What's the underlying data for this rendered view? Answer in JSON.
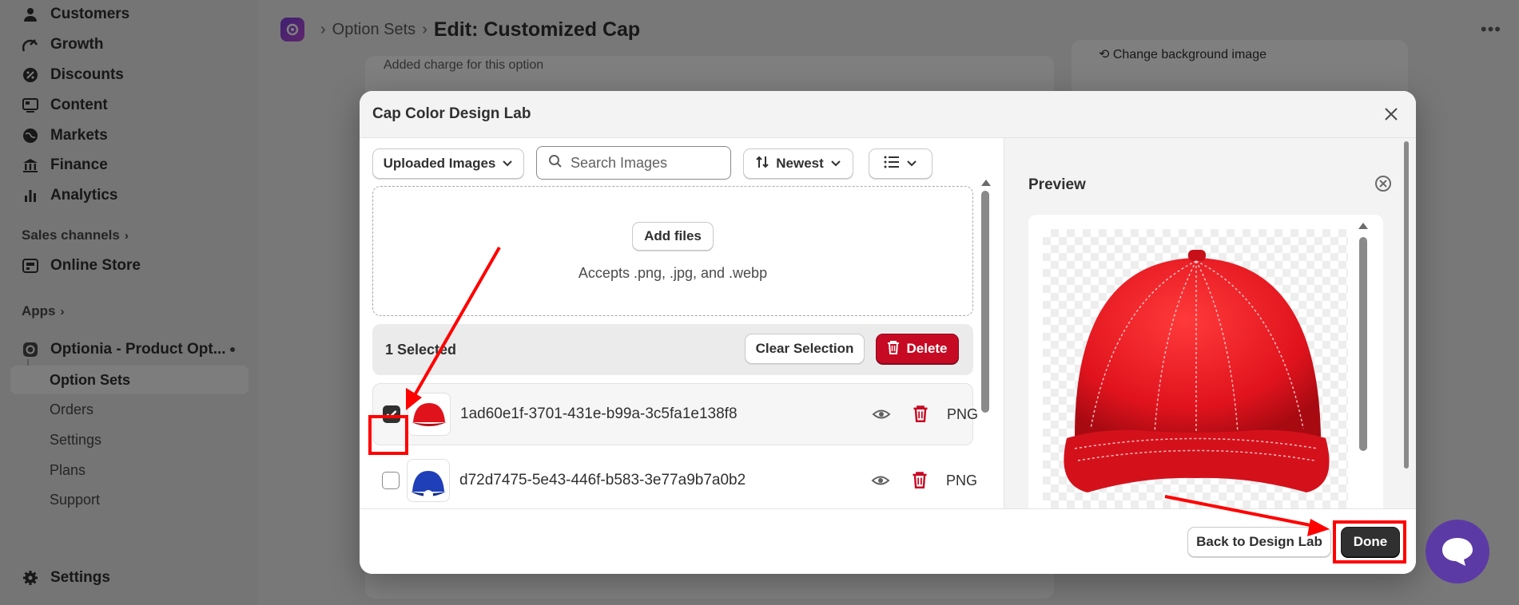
{
  "sidebar": {
    "items": [
      {
        "label": "Customers",
        "icon": "person-icon"
      },
      {
        "label": "Growth",
        "icon": "growth-icon"
      },
      {
        "label": "Discounts",
        "icon": "discount-icon"
      },
      {
        "label": "Content",
        "icon": "content-icon"
      },
      {
        "label": "Markets",
        "icon": "globe-icon"
      },
      {
        "label": "Finance",
        "icon": "bank-icon"
      },
      {
        "label": "Analytics",
        "icon": "bar-chart-icon"
      }
    ],
    "sales_channels_label": "Sales channels",
    "online_store_label": "Online Store",
    "apps_label": "Apps",
    "app_name": "Optionia - Product Opt...",
    "app_sub": [
      "Option Sets",
      "Orders",
      "Settings",
      "Plans",
      "Support"
    ],
    "settings_label": "Settings"
  },
  "topbar": {
    "crumb": "Option Sets",
    "title": "Edit: Customized Cap",
    "more": "•••"
  },
  "background": {
    "charge_text": "Added charge for this option",
    "change_bg": "Change background image"
  },
  "modal": {
    "title": "Cap Color Design Lab",
    "filter_label": "Uploaded Images",
    "search_placeholder": "Search Images",
    "sort_label": "Newest",
    "add_files_label": "Add files",
    "accepts_text": "Accepts .png, .jpg, and .webp",
    "selected_text": "1 Selected",
    "clear_label": "Clear Selection",
    "delete_label": "Delete",
    "files": [
      {
        "name": "1ad60e1f-3701-431e-b99a-3c5fa1e138f8",
        "type": "PNG",
        "checked": true,
        "color": "#e0131d"
      },
      {
        "name": "d72d7475-5e43-446f-b583-3e77a9b7a0b2",
        "type": "PNG",
        "checked": false,
        "color": "#1f3fb8"
      }
    ],
    "preview_title": "Preview",
    "back_label": "Back to Design Lab",
    "done_label": "Done"
  },
  "colors": {
    "annotation": "#ff0000",
    "danger": "#c70a24",
    "cap_red": "#e0131d",
    "chat": "#5c3aa6"
  }
}
